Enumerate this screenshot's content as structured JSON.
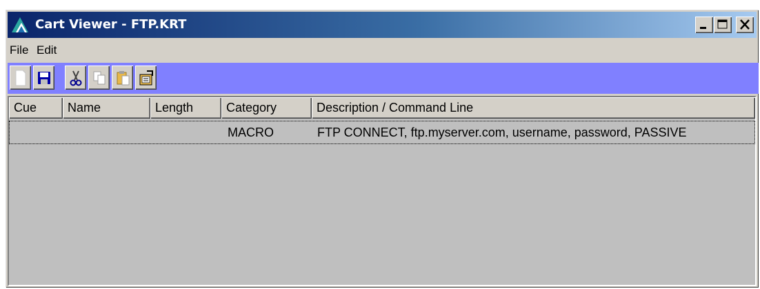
{
  "window": {
    "title": "Cart Viewer - FTP.KRT",
    "minimize_symbol": "_",
    "close_symbol": "×"
  },
  "menu": {
    "items": [
      "File",
      "Edit"
    ]
  },
  "toolbar": {
    "buttons": [
      {
        "icon": "new-document-icon",
        "tooltip": ""
      },
      {
        "icon": "save-disk-icon",
        "tooltip": ""
      },
      {
        "icon": "scissors-cut-icon",
        "tooltip": ""
      },
      {
        "icon": "copy-icon",
        "tooltip": ""
      },
      {
        "icon": "paste-clipboard-icon",
        "tooltip": ""
      },
      {
        "icon": "properties-icon",
        "tooltip": ""
      }
    ],
    "background_color": "#8080ff"
  },
  "table": {
    "columns": [
      "Cue",
      "Name",
      "Length",
      "Category",
      "Description / Command Line"
    ],
    "rows": [
      {
        "cue": "",
        "name": "",
        "length": "",
        "category": "MACRO",
        "description": "FTP CONNECT, ftp.myserver.com, username, password, PASSIVE"
      }
    ]
  }
}
